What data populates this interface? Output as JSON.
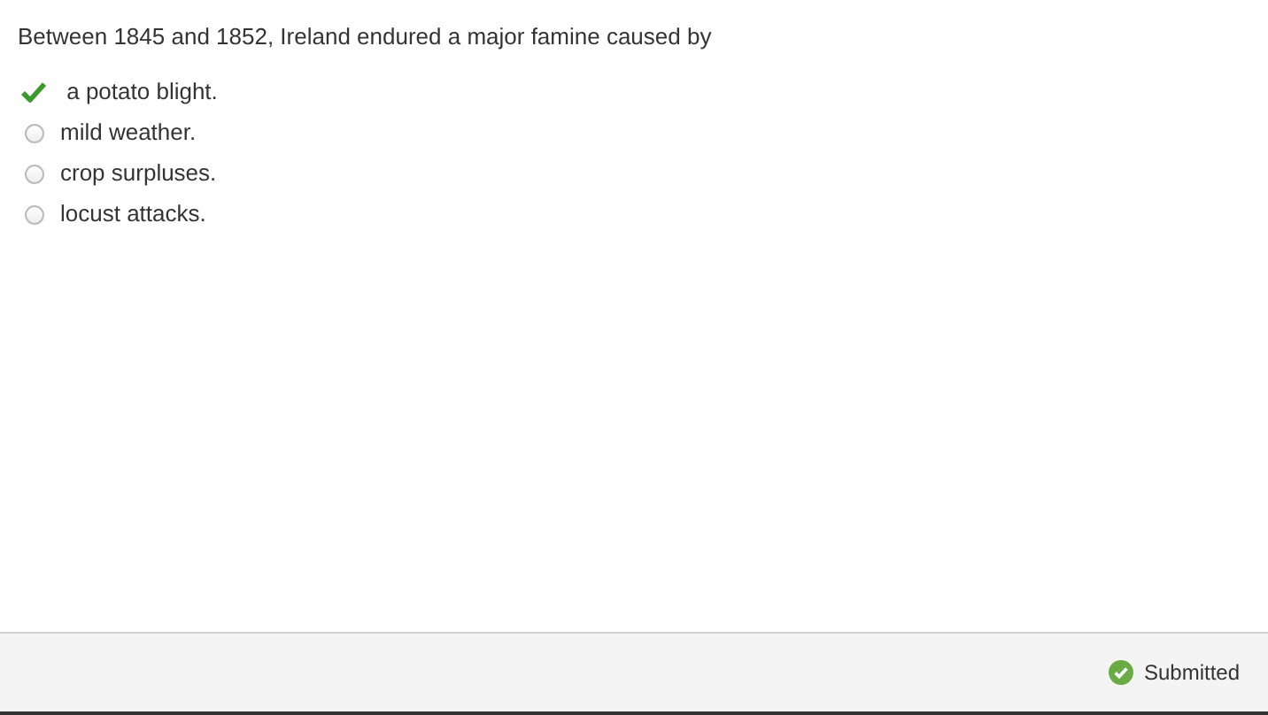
{
  "question": "Between 1845 and 1852, Ireland endured a major famine caused by",
  "options": [
    {
      "label": " a potato blight.",
      "selected": true
    },
    {
      "label": "mild weather.",
      "selected": false
    },
    {
      "label": "crop surpluses.",
      "selected": false
    },
    {
      "label": "locust attacks.",
      "selected": false
    }
  ],
  "status": {
    "label": "Submitted",
    "submitted": true
  }
}
